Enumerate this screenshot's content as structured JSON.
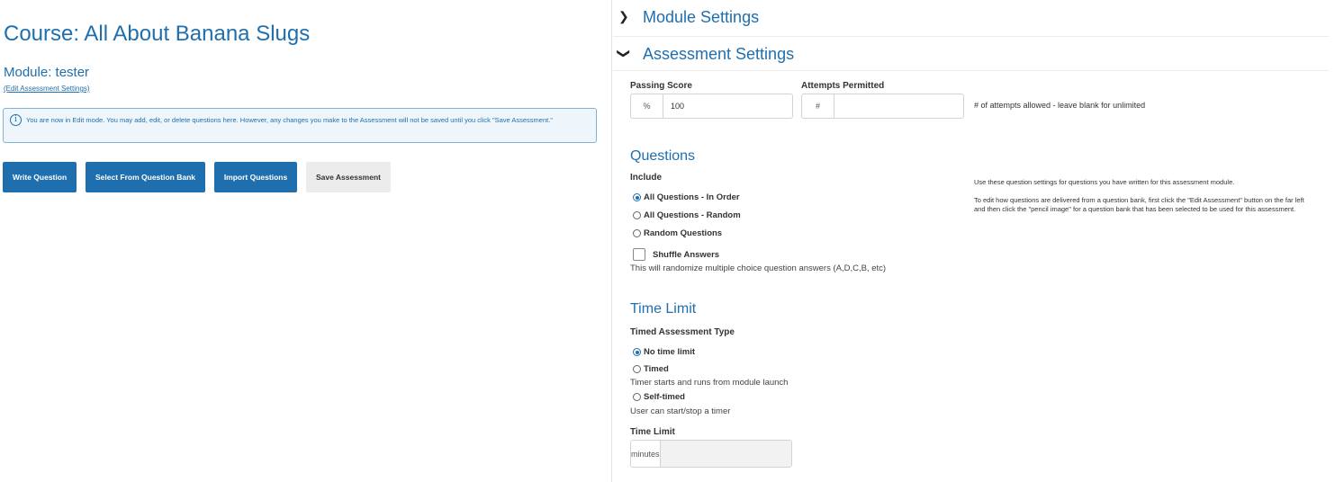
{
  "left": {
    "course_title": "Course: All About Banana Slugs",
    "module_title": "Module: tester",
    "edit_link": "(Edit Assessment Settings)",
    "info_text": "You are now in Edit mode. You may add, edit, or delete questions here. However, any changes you make to the Assessment will not be saved until you click \"Save Assessment.\"",
    "buttons": {
      "write": "Write Question",
      "bank": "Select From Question Bank",
      "import": "Import Questions",
      "save": "Save Assessment"
    }
  },
  "right": {
    "module_settings": "Module Settings",
    "assessment_settings": "Assessment Settings",
    "passing_score_label": "Passing Score",
    "passing_score_addon": "%",
    "passing_score_value": "100",
    "attempts_label": "Attempts Permitted",
    "attempts_addon": "#",
    "attempts_value": "",
    "attempts_help": "# of attempts allowed - leave blank for unlimited",
    "questions": {
      "heading": "Questions",
      "include_label": "Include",
      "options": [
        "All Questions - In Order",
        "All Questions - Random",
        "Random Questions"
      ],
      "selected": "All Questions - In Order",
      "shuffle_label": "Shuffle Answers",
      "shuffle_checked": false,
      "shuffle_help": "This will randomize multiple choice question answers (A,D,C,B, etc)",
      "note1": "Use these question settings for questions you have written for this assessment module.",
      "note2": "To edit how questions are delivered from a question bank, first click the \"Edit Assessment\" button on the far left and then click the \"pencil image\" for a question bank that has been selected to be used for this assessment."
    },
    "time_limit": {
      "heading": "Time Limit",
      "type_label": "Timed Assessment Type",
      "opt_none": "No time limit",
      "opt_timed": "Timed",
      "timed_help": "Timer starts and runs from module launch",
      "opt_self": "Self-timed",
      "self_help": "User can start/stop a timer",
      "selected": "No time limit",
      "limit_label": "Time Limit",
      "limit_addon": "minutes",
      "limit_value": ""
    }
  },
  "colors": {
    "accent": "#1f6fae",
    "info_bg": "#eef6fb",
    "info_border": "#7fb3d5"
  },
  "icons": {
    "info": "info-circle-icon",
    "collapsed": "chevron-right-icon",
    "expanded": "chevron-down-icon"
  }
}
